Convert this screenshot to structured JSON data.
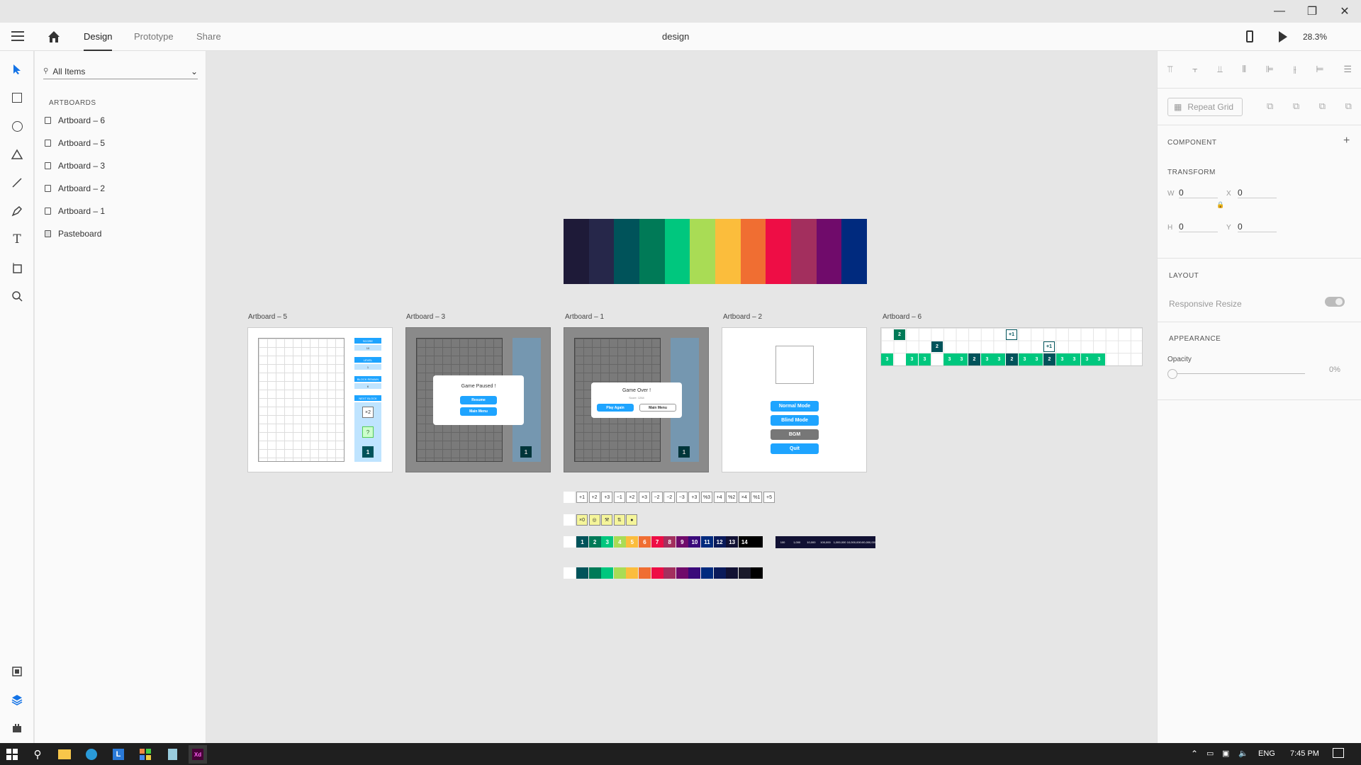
{
  "titlebar": {
    "minimize": "—",
    "restore": "❐",
    "close": "✕"
  },
  "menubar": {
    "tabs": [
      {
        "label": "Design",
        "active": true
      },
      {
        "label": "Prototype",
        "active": false
      },
      {
        "label": "Share",
        "active": false
      }
    ],
    "doc_title": "design",
    "zoom": "28.3%"
  },
  "layers": {
    "search_placeholder": "All Items",
    "section": "ARTBOARDS",
    "items": [
      {
        "label": "Artboard – 6"
      },
      {
        "label": "Artboard – 5"
      },
      {
        "label": "Artboard – 3"
      },
      {
        "label": "Artboard – 2"
      },
      {
        "label": "Artboard – 1"
      },
      {
        "label": "Pasteboard"
      }
    ]
  },
  "canvas": {
    "palette": [
      "#1e1a38",
      "#26274a",
      "#00535a",
      "#007a57",
      "#00c77e",
      "#a9dc55",
      "#fbbd3c",
      "#f06e32",
      "#ee0d45",
      "#a32f5e",
      "#700b6b",
      "#002a7e"
    ],
    "artboards": {
      "a5": {
        "label": "Artboard – 5"
      },
      "a3": {
        "label": "Artboard – 3",
        "dialog_title": "Game Paused !",
        "btn1": "Resume",
        "btn2": "Main Menu"
      },
      "a1": {
        "label": "Artboard – 1",
        "dialog_title": "Game Over !",
        "dialog_sub": "Score: 1264",
        "btn1": "Play Again",
        "btn2": "Main Menu"
      },
      "a2": {
        "label": "Artboard – 2",
        "buttons": [
          {
            "label": "Normal Mode",
            "color": "#1ea4ff"
          },
          {
            "label": "Blind Mode",
            "color": "#1ea4ff"
          },
          {
            "label": "BGM",
            "color": "#777777"
          },
          {
            "label": "Quit",
            "color": "#1ea4ff"
          }
        ]
      },
      "a6": {
        "label": "Artboard – 6",
        "row3": [
          "3",
          "3",
          "3",
          "3",
          "3",
          "2",
          "3",
          "3",
          "2",
          "3",
          "3",
          "2",
          "3",
          "3",
          "3",
          "3"
        ],
        "top_cell": "2",
        "mid_cell": "2",
        "plus_a": "+1",
        "plus_b": "+1"
      }
    },
    "side_info": {
      "score": "SCORE",
      "score_val": "10",
      "level": "LEVEL",
      "level_val": "1",
      "block": "BLOCK REMAIN",
      "block_val": "6",
      "next": "NEXT BLOCK",
      "op": "×2",
      "q": "?",
      "one": "1"
    },
    "ops": [
      "+1",
      "+2",
      "+3",
      "−1",
      "×2",
      "×3",
      "−2",
      "−2",
      "−3",
      "+3",
      "%3",
      "+4",
      "%2",
      "×4",
      "%1",
      "+5"
    ],
    "specials": [
      "×0",
      "",
      "",
      "",
      ""
    ],
    "numbers": [
      {
        "n": "1",
        "c": "#00535a"
      },
      {
        "n": "2",
        "c": "#007a57"
      },
      {
        "n": "3",
        "c": "#00c77e"
      },
      {
        "n": "4",
        "c": "#a9dc55"
      },
      {
        "n": "5",
        "c": "#fbbd3c"
      },
      {
        "n": "6",
        "c": "#f06e32"
      },
      {
        "n": "7",
        "c": "#ee0d45"
      },
      {
        "n": "8",
        "c": "#a32f5e"
      },
      {
        "n": "9",
        "c": "#700b6b"
      },
      {
        "n": "10",
        "c": "#3a0a7a"
      },
      {
        "n": "11",
        "c": "#002a7e"
      },
      {
        "n": "12",
        "c": "#0a1a5a"
      },
      {
        "n": "13",
        "c": "#111133"
      },
      {
        "n": "14",
        "c": "#000000"
      }
    ],
    "scores": [
      "100",
      "1,000",
      "10,000",
      "100,000",
      "1,000,000",
      "10,000,000",
      "100,000,000"
    ],
    "colors_row": [
      "#00535a",
      "#007a57",
      "#00c77e",
      "#a9dc55",
      "#fbbd3c",
      "#f06e32",
      "#ee0d45",
      "#a32f5e",
      "#700b6b",
      "#3a0a7a",
      "#002a7e",
      "#0a1a5a",
      "#111133",
      "#1a1a2a",
      "#000000"
    ]
  },
  "props": {
    "repeat_grid": "Repeat Grid",
    "component": "COMPONENT",
    "transform": "TRANSFORM",
    "w_label": "W",
    "w_val": "0",
    "x_label": "X",
    "x_val": "0",
    "h_label": "H",
    "h_val": "0",
    "y_label": "Y",
    "y_val": "0",
    "layout": "LAYOUT",
    "responsive": "Responsive Resize",
    "appearance": "APPEARANCE",
    "opacity_label": "Opacity",
    "opacity_val": "0%"
  },
  "taskbar": {
    "lang": "ENG",
    "time": "7:45 PM"
  }
}
